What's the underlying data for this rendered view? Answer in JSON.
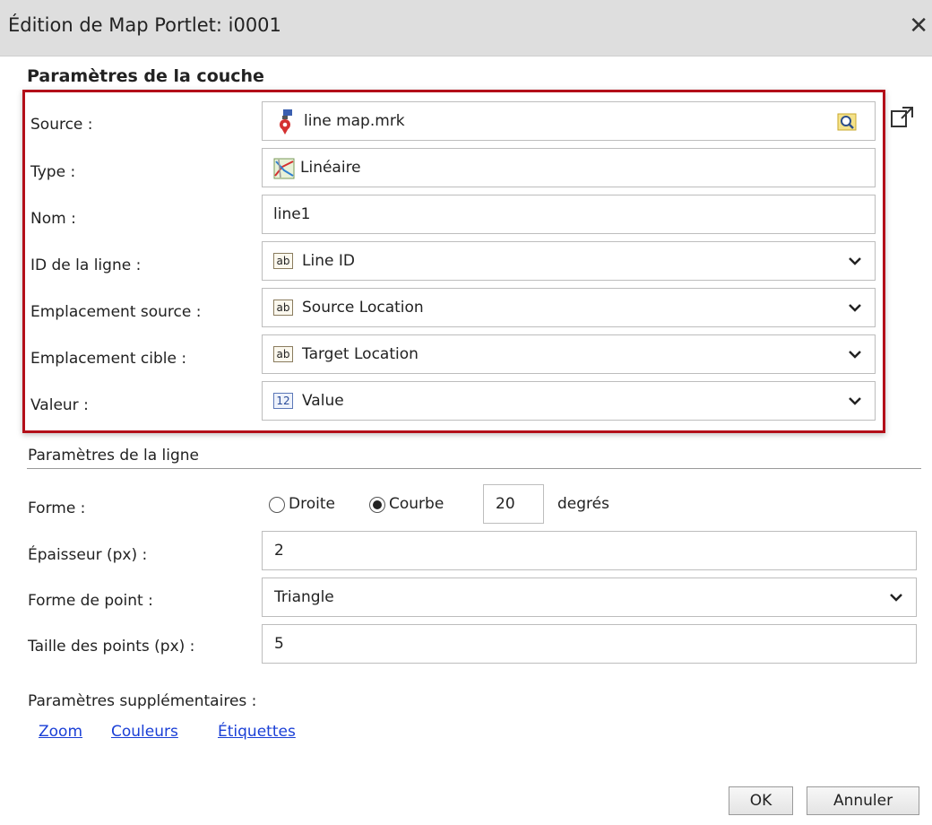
{
  "window": {
    "title": "Édition de Map Portlet: i0001",
    "close_glyph": "✕"
  },
  "layer_section": {
    "title": "Paramètres de la couche",
    "source": {
      "label": "Source :",
      "value": "line map.mrk",
      "icon": "map-marker-icon",
      "browse_icon": "search-folder-icon"
    },
    "type": {
      "label": "Type :",
      "value": "Linéaire",
      "icon": "linear-map-icon"
    },
    "name": {
      "label": "Nom :",
      "value": "line1"
    },
    "line_id": {
      "label": "ID de la ligne :",
      "value": "Line ID",
      "icon_text": "ab"
    },
    "source_location": {
      "label": "Emplacement source :",
      "value": "Source Location",
      "icon_text": "ab"
    },
    "target_location": {
      "label": "Emplacement cible :",
      "value": "Target Location",
      "icon_text": "ab"
    },
    "value": {
      "label": "Valeur :",
      "value": "Value",
      "icon_text": "12"
    }
  },
  "line_section": {
    "title": "Paramètres de la ligne",
    "shape": {
      "label": "Forme :",
      "option_straight": "Droite",
      "option_curve": "Courbe",
      "selected": "Courbe",
      "degrees_value": "20",
      "degrees_unit": "degrés"
    },
    "thickness": {
      "label": "Épaisseur (px) :",
      "value": "2"
    },
    "point_shape": {
      "label": "Forme de point :",
      "value": "Triangle"
    },
    "point_size": {
      "label": "Taille des points (px) :",
      "value": "5"
    }
  },
  "extra": {
    "label": "Paramètres supplémentaires :",
    "links": [
      "Zoom",
      "Couleurs",
      "Étiquettes"
    ]
  },
  "footer": {
    "ok_label": "OK",
    "cancel_label": "Annuler"
  },
  "colors": {
    "highlight_border": "#b30f19",
    "link": "#1a3fd6",
    "titlebar": "#dedede"
  }
}
